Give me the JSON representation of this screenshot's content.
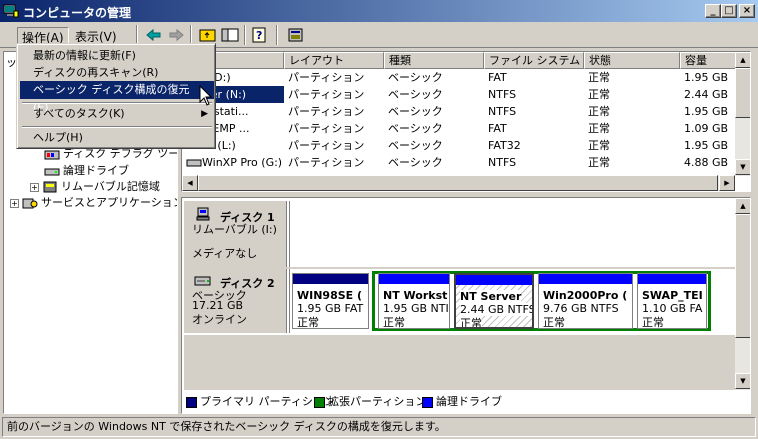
{
  "window": {
    "title": "コンピュータの管理"
  },
  "menu": {
    "action": "操作(A)",
    "view": "表示(V)"
  },
  "context_menu": {
    "items": [
      "最新の情報に更新(F)",
      "ディスクの再スキャン(R)",
      "ベーシック ディスク構成の復元(E)...",
      "すべてのタスク(K)",
      "ヘルプ(H)"
    ],
    "highlighted_index": 2
  },
  "tree": {
    "items": [
      "ディスク デフラグ ツール",
      "論理ドライブ",
      "リムーバブル記憶域",
      "サービスとアプリケーション"
    ],
    "prefix_clipped": "ッ"
  },
  "volume_list": {
    "columns": [
      "ーム",
      "レイアウト",
      "種類",
      "ファイル システム",
      "状態",
      "容量"
    ],
    "rows": [
      [
        "TA1 (D:)",
        "パーティション",
        "ベーシック",
        "FAT",
        "正常",
        "1.95 GB"
      ],
      [
        " Server (N:)",
        "パーティション",
        "ベーシック",
        "NTFS",
        "正常",
        "2.44 GB"
      ],
      [
        "Workstati...",
        "パーティション",
        "ベーシック",
        "NTFS",
        "正常",
        "1.95 GB"
      ],
      [
        "AP_TEMP ...",
        "パーティション",
        "ベーシック",
        "FAT",
        "正常",
        "1.09 GB"
      ],
      [
        "98SE (L:)",
        "パーティション",
        "ベーシック",
        "FAT32",
        "正常",
        "1.95 GB"
      ],
      [
        "WinXP Pro (G:)",
        "パーティション",
        "ベーシック",
        "NTFS",
        "正常",
        "4.88 GB"
      ]
    ],
    "selected_row": 1
  },
  "disks": [
    {
      "name": "ディスク 1",
      "type": "リムーバブル (I:)",
      "status": "メディアなし"
    },
    {
      "name": "ディスク 2",
      "type": "ベーシック",
      "size": "17.21 GB",
      "status": "オンライン"
    }
  ],
  "partitions": [
    {
      "name": "WIN98SE (",
      "size": "1.95 GB FAT",
      "status": "正常",
      "bar_color": "#000080"
    },
    {
      "name": "NT Workst",
      "size": "1.95 GB NTI",
      "status": "正常",
      "bar_color": "#0000ff"
    },
    {
      "name": "NT Server",
      "size": "2.44 GB NTFS",
      "status": "正常",
      "bar_color": "#0000ff"
    },
    {
      "name": "Win2000Pro (",
      "size": "9.76 GB NTFS",
      "status": "正常",
      "bar_color": "#0000ff"
    },
    {
      "name": "SWAP_TEI",
      "size": "1.10 GB FA",
      "status": "正常",
      "bar_color": "#0000ff"
    }
  ],
  "legend": [
    {
      "label": "プライマリ パーティション",
      "color": "#000080"
    },
    {
      "label": "拡張パーティション",
      "color": "#008000"
    },
    {
      "label": "論理ドライブ",
      "color": "#0000ff"
    }
  ],
  "status_bar": {
    "text": "前のバージョンの Windows NT で保存されたベーシック ディスクの構成を復元します。"
  }
}
